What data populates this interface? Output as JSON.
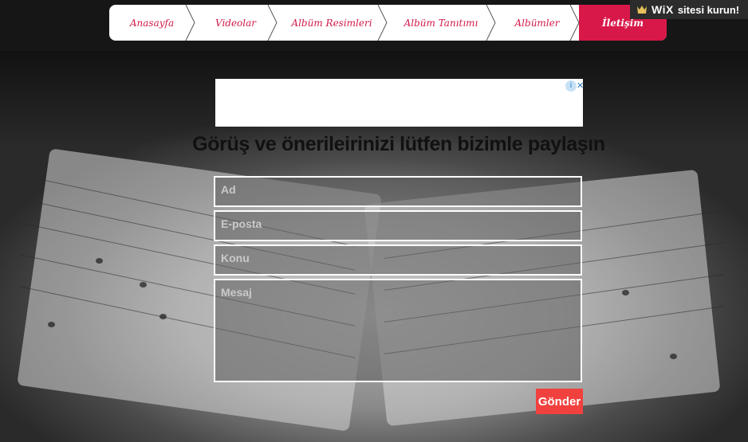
{
  "nav": {
    "items": [
      {
        "label": "Anasayfa",
        "active": false
      },
      {
        "label": "Videolar",
        "active": false
      },
      {
        "label": "Albüm Resimleri",
        "active": false
      },
      {
        "label": "Albüm Tanıtımı",
        "active": false
      },
      {
        "label": "Albümler",
        "active": false
      },
      {
        "label": "İletişim",
        "active": true
      }
    ]
  },
  "wix_banner": {
    "brand": "WiX",
    "text": "sitesi kurun!",
    "icon": "wix-crown-icon"
  },
  "ad": {
    "info_icon": "info-icon",
    "close_label": "✕"
  },
  "contact": {
    "heading": "Görüş ve önerileirinizi lütfen bizimle paylaşın",
    "name_placeholder": "Ad",
    "email_placeholder": "E-posta",
    "subject_placeholder": "Konu",
    "message_placeholder": "Mesaj",
    "submit_label": "Gönder"
  },
  "colors": {
    "accent": "#d9184a",
    "button": "#f1413e",
    "nav_text": "#d11a4a"
  }
}
